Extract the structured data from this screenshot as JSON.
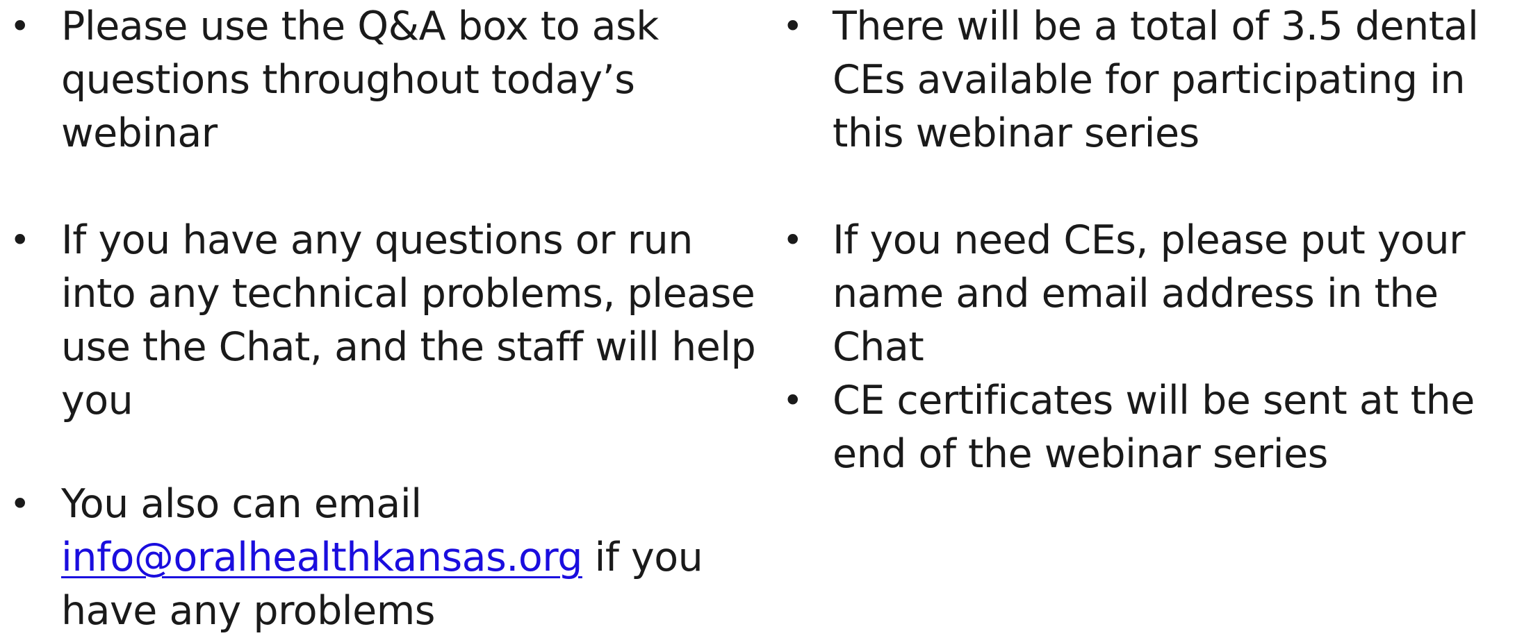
{
  "left_column": {
    "items": [
      {
        "text": "Please use the Q&A box to ask questions throughout today’s webinar"
      },
      {
        "text": "If you have any questions or run into any technical problems, please use the Chat, and the staff will help you"
      },
      {
        "prefix": "You also can email ",
        "link": "info@oralhealthkansas.org",
        "suffix": " if you have any problems"
      }
    ]
  },
  "right_column": {
    "items": [
      {
        "text": "There will be a total of 3.5 dental CEs available for participating in this webinar series"
      },
      {
        "text": "If you need CEs, please put your name and email address in the Chat"
      },
      {
        "text": "CE certificates will be sent at the end of the webinar series"
      }
    ]
  },
  "bullet_glyph": "•",
  "colors": {
    "text": "#1a1a1a",
    "link": "#1a0dde",
    "background": "#ffffff"
  }
}
